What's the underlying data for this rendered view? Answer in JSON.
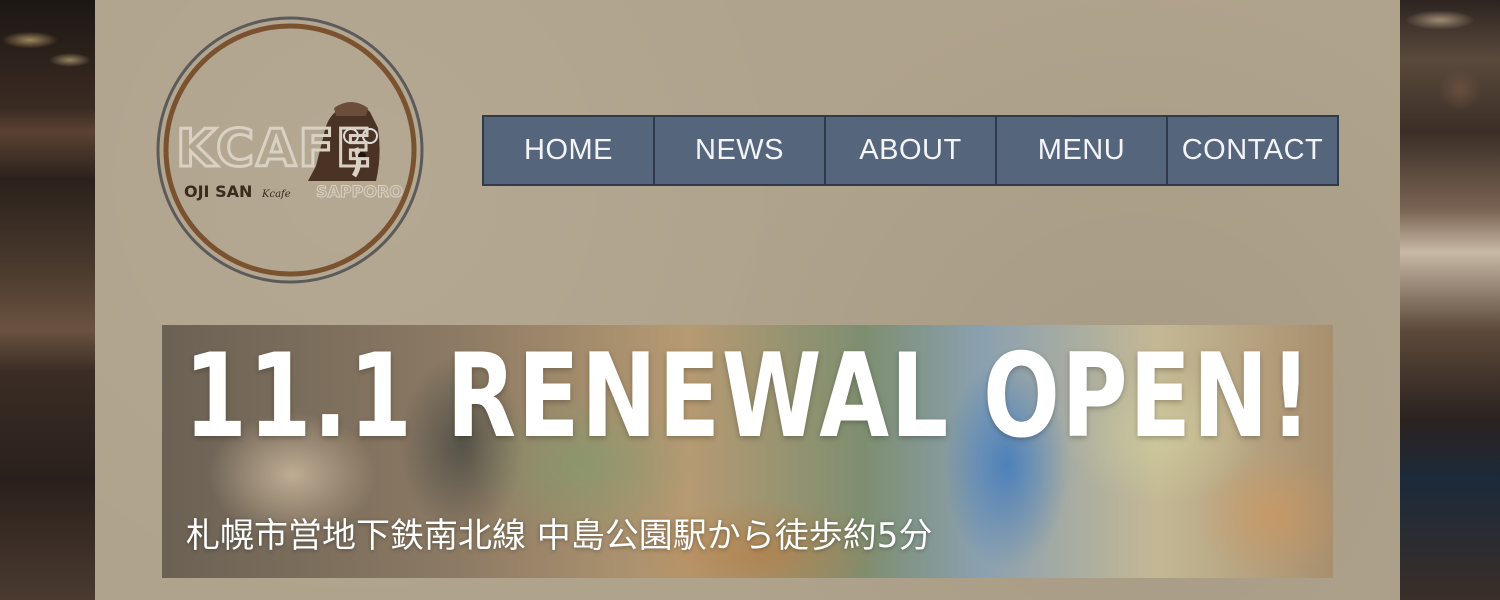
{
  "logo": {
    "brand": "KCAFE",
    "left_text": "OJI SAN",
    "right_text": "SAPPORO",
    "script_text": "Kcafe"
  },
  "nav": {
    "items": [
      {
        "label": "HOME"
      },
      {
        "label": "NEWS"
      },
      {
        "label": "ABOUT"
      },
      {
        "label": "MENU"
      },
      {
        "label": "CONTACT"
      }
    ]
  },
  "banner": {
    "title": "11.1 RENEWAL OPEN!",
    "subtitle": "札幌市営地下鉄南北線 中島公園駅から徒歩約5分"
  },
  "colors": {
    "panel": "#b0a38c",
    "nav_bg": "#55667c",
    "nav_border": "#2f3a4a",
    "logo_ring": "#7a5230"
  }
}
